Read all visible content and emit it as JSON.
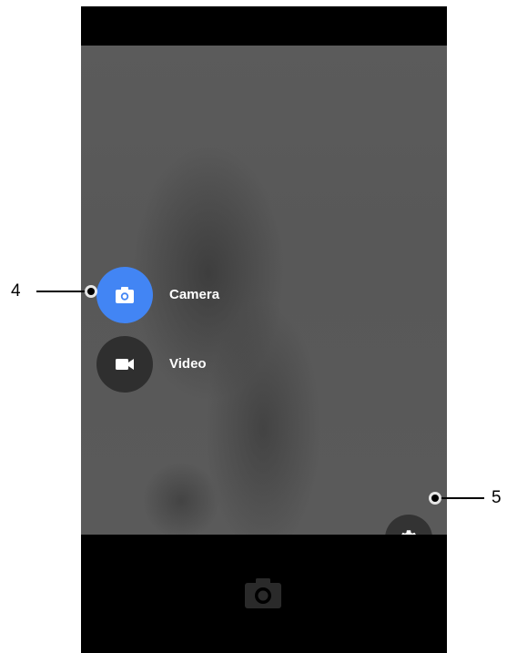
{
  "camera_app": {
    "modes": [
      {
        "label": "Camera",
        "icon": "camera-icon",
        "selected": true,
        "color": "#4285f4"
      },
      {
        "label": "Video",
        "icon": "video-camera-icon",
        "selected": false,
        "color": "#2f2f2f"
      }
    ],
    "settings": {
      "icon": "gear-icon"
    },
    "shutter": {
      "icon": "camera-shutter-icon"
    }
  },
  "callouts": {
    "mode_menu": "4",
    "settings": "5"
  }
}
